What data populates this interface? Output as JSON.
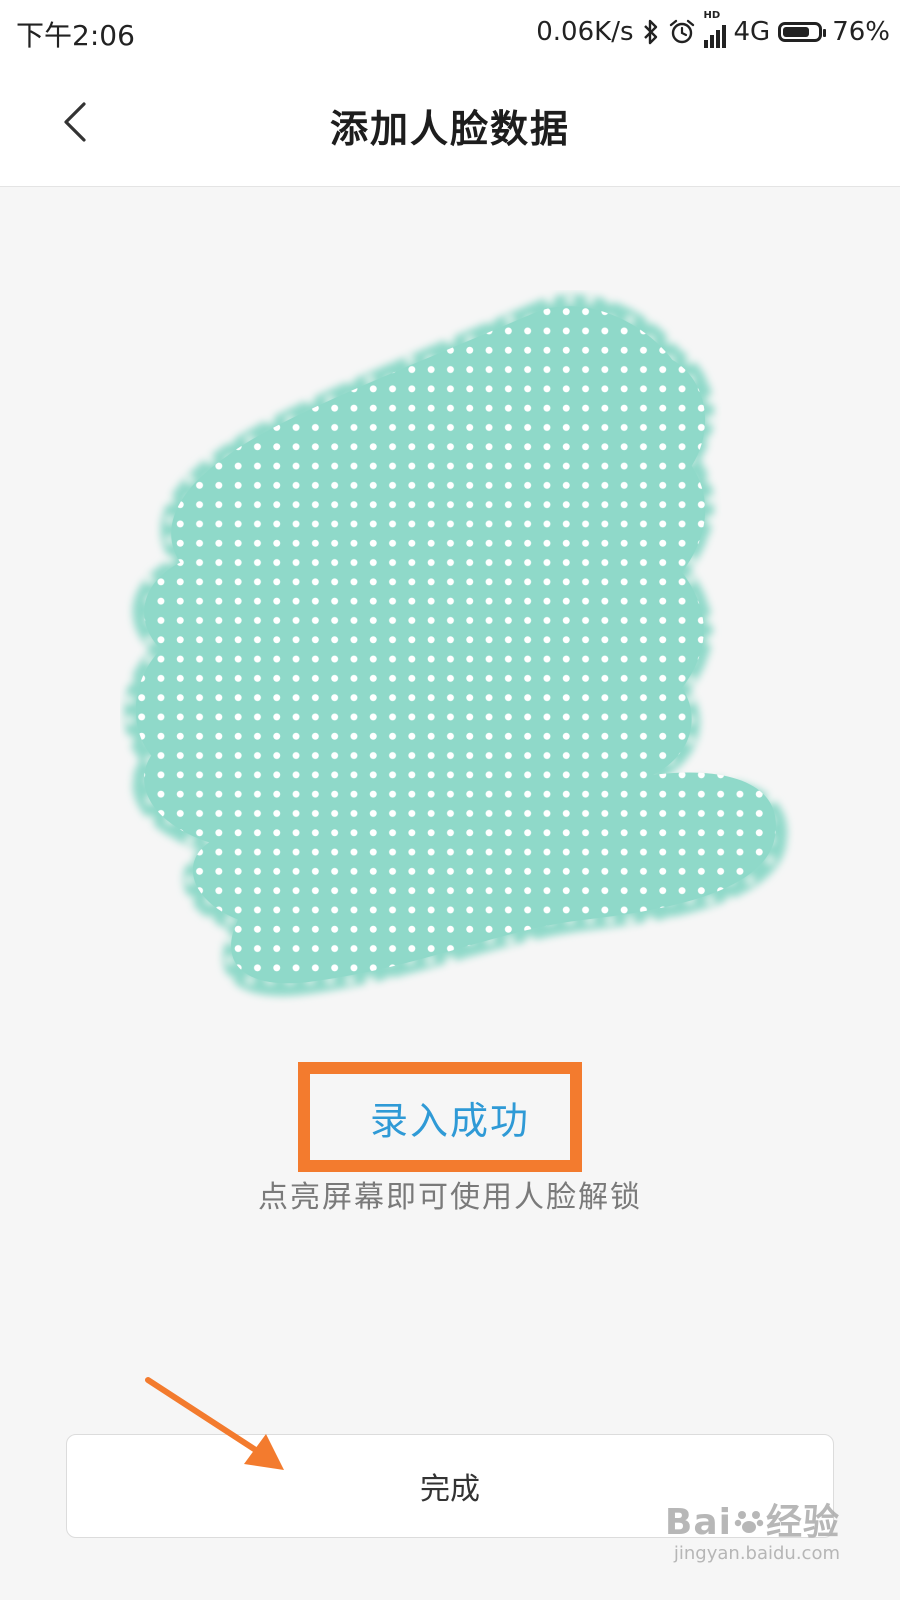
{
  "status_bar": {
    "time": "下午2:06",
    "net_speed": "0.06K/s",
    "network": "4G",
    "hd_label": "HD",
    "battery_percent": "76%",
    "battery_level": 0.76,
    "icons": [
      "bluetooth-icon",
      "alarm-icon",
      "signal-icon",
      "battery-icon"
    ]
  },
  "header": {
    "title": "添加人脸数据",
    "back_icon": "chevron-left-icon"
  },
  "main": {
    "success_label": "录入成功",
    "hint": "点亮屏幕即可使用人脸解锁",
    "done_button": "完成"
  },
  "annotations": {
    "highlight_color": "#f37b2e",
    "arrow_color": "#f37b2e"
  },
  "colors": {
    "accent": "#2f9ad6",
    "face_fill": "#8fd9c9",
    "background": "#f6f6f6"
  },
  "watermark": {
    "brand_left": "Bai",
    "brand_right": "经验",
    "url": "jingyan.baidu.com"
  }
}
